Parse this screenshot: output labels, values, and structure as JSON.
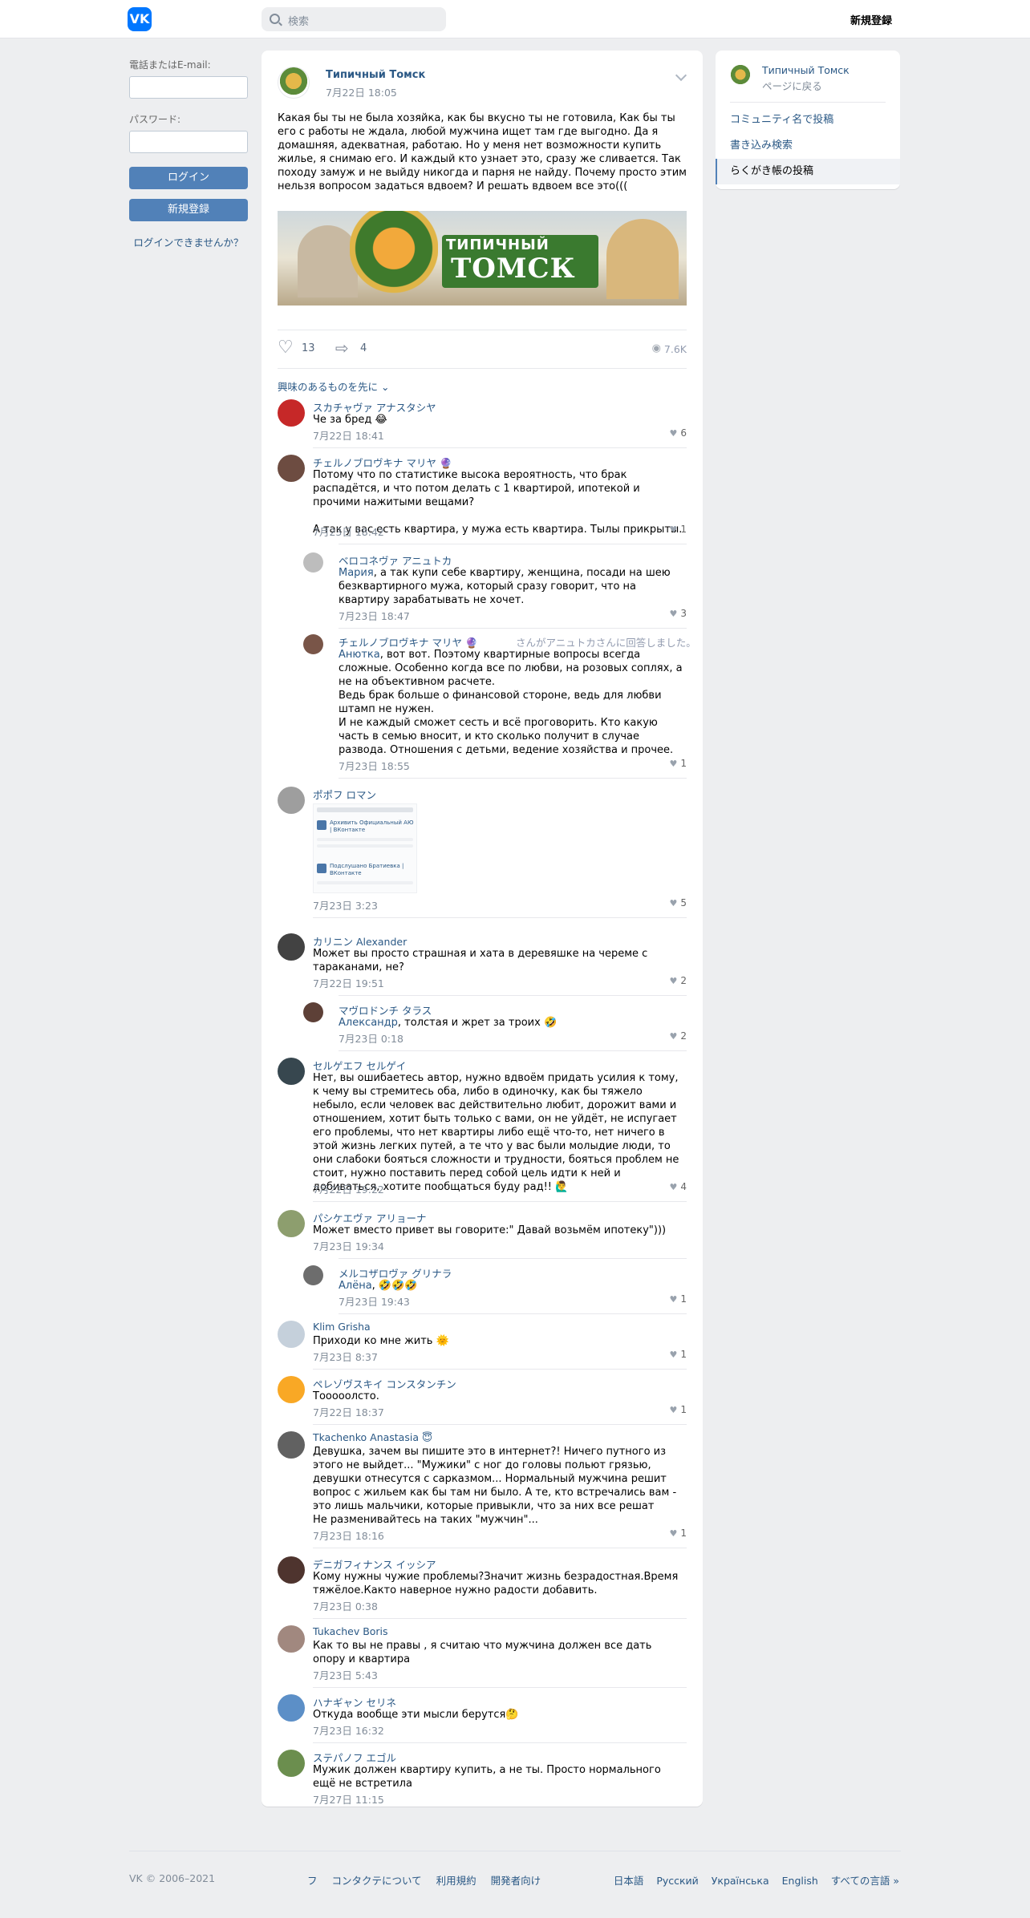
{
  "header": {
    "logo_text": "VK",
    "search_placeholder": "検索",
    "register_label": "新規登録"
  },
  "login": {
    "email_label": "電話またはE-mail:",
    "password_label": "パスワード:",
    "login_button": "ログイン",
    "register_button": "新規登録",
    "forgot_link": "ログインできませんか？"
  },
  "post": {
    "group_name": "Типичный Томск",
    "date": "7月22日 18:05",
    "text": "Какая бы ты не была хозяйка, как бы вкусно ты не готовила, Как бы ты его с работы не ждала, любой мужчина ищет там где выгодно. Да я домашняя, адекватная, работаю. Но у меня нет возможности купить жилье, я снимаю его. И каждый кто узнает это, сразу же сливается. Так походу замуж и не выйду никогда и парня не найду. Почему просто этим нельзя вопросом задаться вдвоем? И решать вдвоем все это(((",
    "image_title": "ТИПИЧНЫЙ",
    "image_city": "ТОМСК",
    "likes": "13",
    "shares": "4",
    "views": "7.6K",
    "sort_label": "興味のあるものを先に ⌄"
  },
  "comments": [
    {
      "name": "スカチャヴァ アナスタシヤ",
      "text": "Че за бред 😂",
      "date": "7月22日 18:41",
      "likes": "6"
    },
    {
      "name": "チェルノブロヴキナ マリヤ 🔮",
      "text": "Потому что по статистике высока вероятность, что брак распадётся, и что потом делать с 1 квартирой, ипотекой и прочими нажитыми вещами?\n\nА так у вас есть квартира, у мужа есть квартира. Тылы прикрыты.",
      "date": "7月23日 18:42",
      "likes": "1"
    },
    {
      "name": "ベロコネヴァ アニュトカ",
      "reply_to": "Мария",
      "text": ", а так купи себе квартиру, женщина, посади на шею безквартирного мужа, который сразу говорит, что на квартиру зарабатывать не хочет.",
      "date": "7月23日 18:47",
      "likes": "3"
    },
    {
      "name": "チェルノブロヴキナ マリヤ 🔮",
      "note": "さんがアニュトカさんに回答しました。",
      "reply_to": "Анютка",
      "text": ", вот вот. Поэтому квартирные вопросы всегда сложные. Особенно когда все по любви, на розовых соплях, а не на объективном расчете.\nВедь брак больше о финансовой стороне, ведь для любви штамп не нужен.\nИ не каждый сможет сесть и всё проговорить. Кто какую часть в семью вносит, и кто сколько получит в случае развода. Отношения с детьми, ведение хозяйства и прочее.",
      "date": "7月23日 18:55",
      "likes": "1"
    },
    {
      "name": "ポポフ ロマン",
      "date": "7月23日 3:23",
      "likes": "5",
      "thumb_lines": [
        "Архивить Официальный АЮ | ВКонтакте",
        "Подслушано Братиевка | ВКонтакте"
      ]
    },
    {
      "name": "カリニン Alexander",
      "text": "Может вы просто страшная и хата в деревяшке на череме с тараканами, не?",
      "date": "7月22日 19:51",
      "likes": "2"
    },
    {
      "name": "マヴロドンチ タラス",
      "reply_to": "Александр",
      "text": ", толстая и жрет за троих 🤣",
      "date": "7月23日 0:18",
      "likes": "2"
    },
    {
      "name": "セルゲエフ セルゲイ",
      "text": "Нет, вы ошибаетесь автор, нужно вдвоём придать усилия к тому, к чему вы стремитесь оба, либо в одиночку, как бы тяжело небыло, если человек вас действительно любит, дорожит вами и отношением, хотит быть только с вами, он не уйдёт, не испугает его проблемы, что нет квартиры либо ещё что-то, нет ничего в этой жизнь легких путей, а те что у вас были молыдие люди, то они слабоки бояться сложности и трудности, бояться проблем не стоит, нужно поставить перед собой цель идти к ней и добиваться, хотите пообщаться буду рад!! 🙋‍♂️",
      "date": "7月22日 19:22",
      "likes": "4"
    },
    {
      "name": "パシケエヴァ アリョーナ",
      "text": "Может вместо привет вы говорите:\" Давай возьмём ипотеку\")))",
      "date": "7月23日 19:34",
      "likes": ""
    },
    {
      "name": "メルコザロヴァ グリナラ",
      "reply_to": "Алёна",
      "text": ", 🤣🤣🤣",
      "date": "7月23日 19:43",
      "likes": "1"
    },
    {
      "name": "Klim Grisha",
      "text": "Приходи ко мне жить 🌞",
      "date": "7月23日 8:37",
      "likes": "1"
    },
    {
      "name": "ペレゾヴスキイ コンスタンチン",
      "text": "Тооооолсто.",
      "date": "7月22日 18:37",
      "likes": "1"
    },
    {
      "name": "Tkachenko Anastasia 😇",
      "text": "Девушка, зачем вы пишите это в интернет?! Ничего путного из этого не выйдет... \"Мужики\" с ног до головы польют грязью, девушки отнесутся с сарказмом... Нормальный мужчина решит вопрос с жильем как бы там ни было. А те, кто встречались вам - это лишь мальчики, которые привыкли, что за них все решат\nНе разменивайтесь на таких \"мужчин\"...",
      "date": "7月23日 18:16",
      "likes": "1"
    },
    {
      "name": "デニガフィナンス イッシア",
      "text": "Кому нужны чужие проблемы?Значит жизнь безрадостная.Время тяжёлое.Както наверное нужно радости добавить.",
      "date": "7月23日 0:38",
      "likes": ""
    },
    {
      "name": "Tukachev Boris",
      "text": "Как то вы не правы , я считаю что мужчина должен все дать опору и квартира",
      "date": "7月23日 5:43",
      "likes": ""
    },
    {
      "name": "ハナギャン セリネ",
      "text": "Откуда вообще эти мысли берутся🤔",
      "date": "7月23日 16:32",
      "likes": ""
    },
    {
      "name": "ステパノフ エゴル",
      "text": "Мужик должен квартиру купить, а не ты. Просто нормального ещё не встретила",
      "date": "7月27日 11:15",
      "likes": ""
    }
  ],
  "sidebar": {
    "group_name": "Типичный Томск",
    "back_label": "ページに戻る",
    "links": [
      "コミュニティ名で投稿",
      "書き込み検索",
      "らくがき帳の投稿"
    ]
  },
  "footer": {
    "copyright": "VK © 2006–2021",
    "links": [
      "フ",
      "コンタクテについて",
      "利用規約",
      "開発者向け"
    ],
    "languages": [
      "日本語",
      "Русский",
      "Українська",
      "English",
      "すべての言語 »"
    ]
  },
  "colors": {
    "accent": "#2a5885",
    "button": "#5181b8",
    "brand": "#0077ff",
    "background": "#edeef0"
  }
}
